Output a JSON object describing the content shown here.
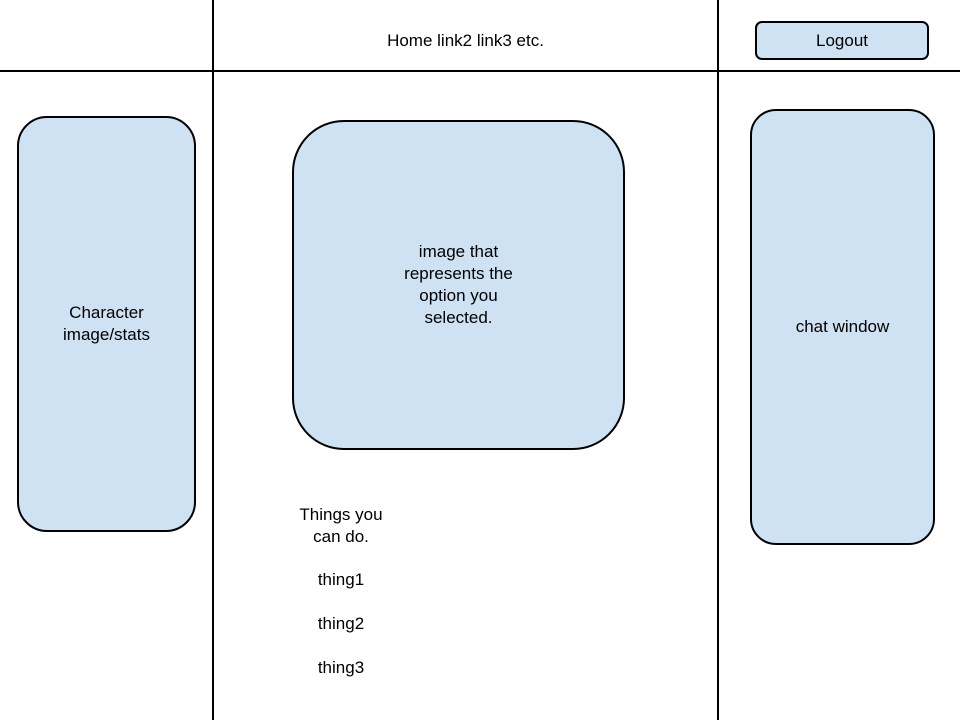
{
  "header": {
    "nav_text": "Home link2 link3 etc.",
    "logout_label": "Logout"
  },
  "left_panel": {
    "character_box_label": "Character\nimage/stats"
  },
  "main": {
    "image_box_label": "image that\nrepresents the\noption you\nselected.",
    "things_heading": "Things you\ncan do.",
    "things": [
      "thing1",
      "thing2",
      "thing3"
    ]
  },
  "right_panel": {
    "chat_box_label": "chat window"
  },
  "colors": {
    "box_fill": "#cfe2f3",
    "stroke": "#000000"
  }
}
